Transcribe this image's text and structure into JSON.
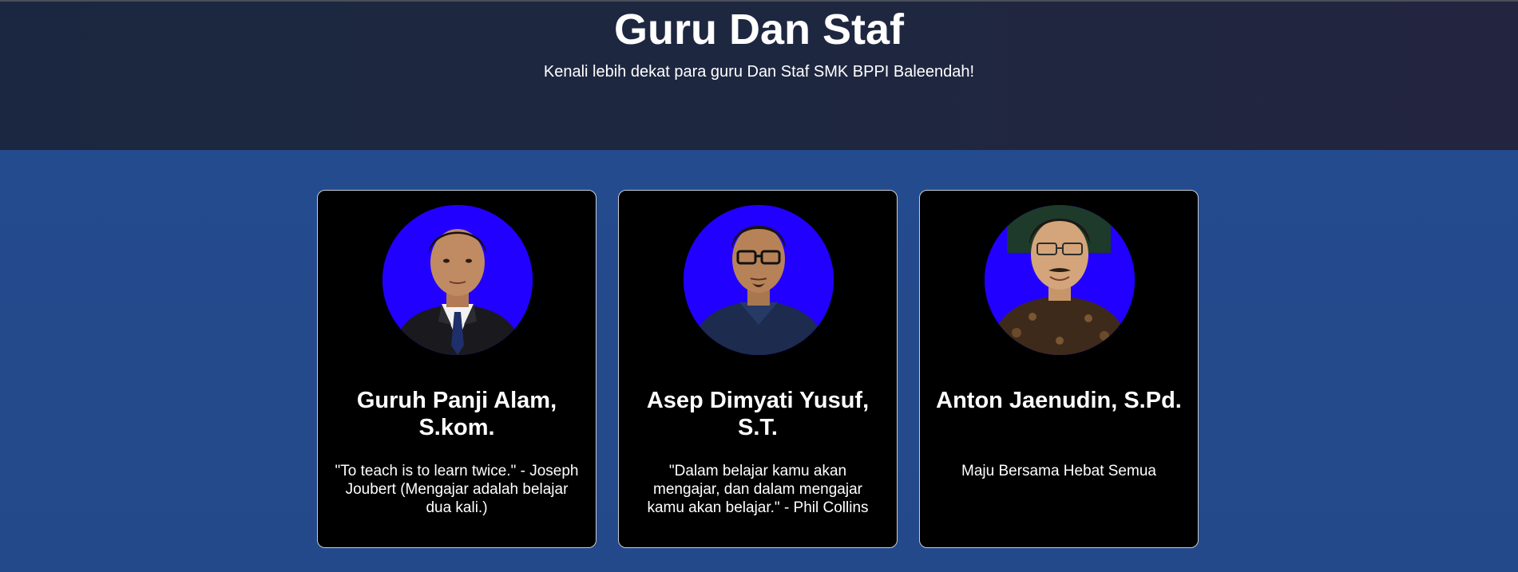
{
  "header": {
    "title": "Guru Dan Staf",
    "subtitle": "Kenali lebih dekat para guru Dan Staf SMK BPPI Baleendah!"
  },
  "colors": {
    "header_bg": "#1f2740",
    "page_bg": "#244a8c",
    "card_bg": "#000000",
    "avatar_bg": "#2200ff",
    "text": "#ffffff"
  },
  "staff": [
    {
      "name": "Guruh Panji Alam, S.kom.",
      "quote": "\"To teach is to learn twice.\" - Joseph Joubert (Mengajar adalah belajar dua kali.)",
      "photo_icon": "portrait-suit-icon"
    },
    {
      "name": "Asep Dimyati Yusuf, S.T.",
      "quote": "\"Dalam belajar kamu akan mengajar, dan dalam mengajar kamu akan belajar.\" - Phil Collins",
      "photo_icon": "portrait-glasses-icon"
    },
    {
      "name": "Anton Jaenudin, S.Pd.",
      "quote": "Maju Bersama Hebat Semua",
      "photo_icon": "portrait-batik-icon"
    }
  ]
}
